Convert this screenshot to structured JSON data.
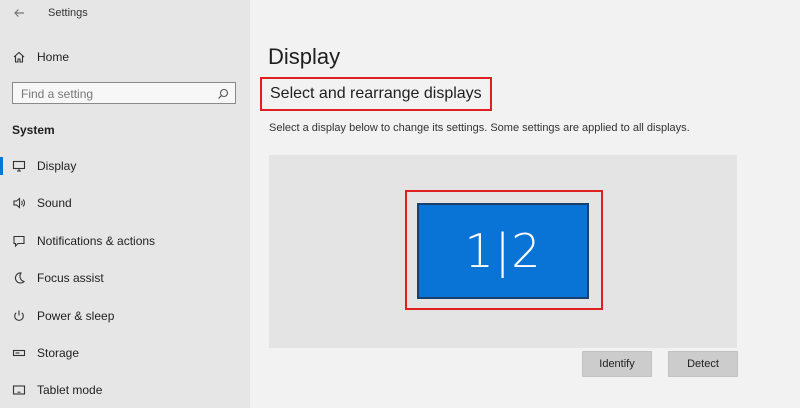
{
  "app": {
    "title": "Settings"
  },
  "sidebar": {
    "home_label": "Home",
    "search_placeholder": "Find a setting",
    "section": "System",
    "items": [
      {
        "label": "Display",
        "icon": "monitor-icon",
        "active": true
      },
      {
        "label": "Sound",
        "icon": "speaker-icon",
        "active": false
      },
      {
        "label": "Notifications & actions",
        "icon": "notification-icon",
        "active": false
      },
      {
        "label": "Focus assist",
        "icon": "moon-icon",
        "active": false
      },
      {
        "label": "Power & sleep",
        "icon": "power-icon",
        "active": false
      },
      {
        "label": "Storage",
        "icon": "storage-icon",
        "active": false
      },
      {
        "label": "Tablet mode",
        "icon": "tablet-icon",
        "active": false
      }
    ]
  },
  "main": {
    "title": "Display",
    "subtitle": "Select and rearrange displays",
    "description": "Select a display below to change its settings. Some settings are applied to all displays.",
    "monitor_label": "1|2",
    "buttons": {
      "identify": "Identify",
      "detect": "Detect"
    }
  },
  "colors": {
    "accent": "#0078d7",
    "monitor_fill": "#0a74d6",
    "highlight_border": "#e02020"
  }
}
